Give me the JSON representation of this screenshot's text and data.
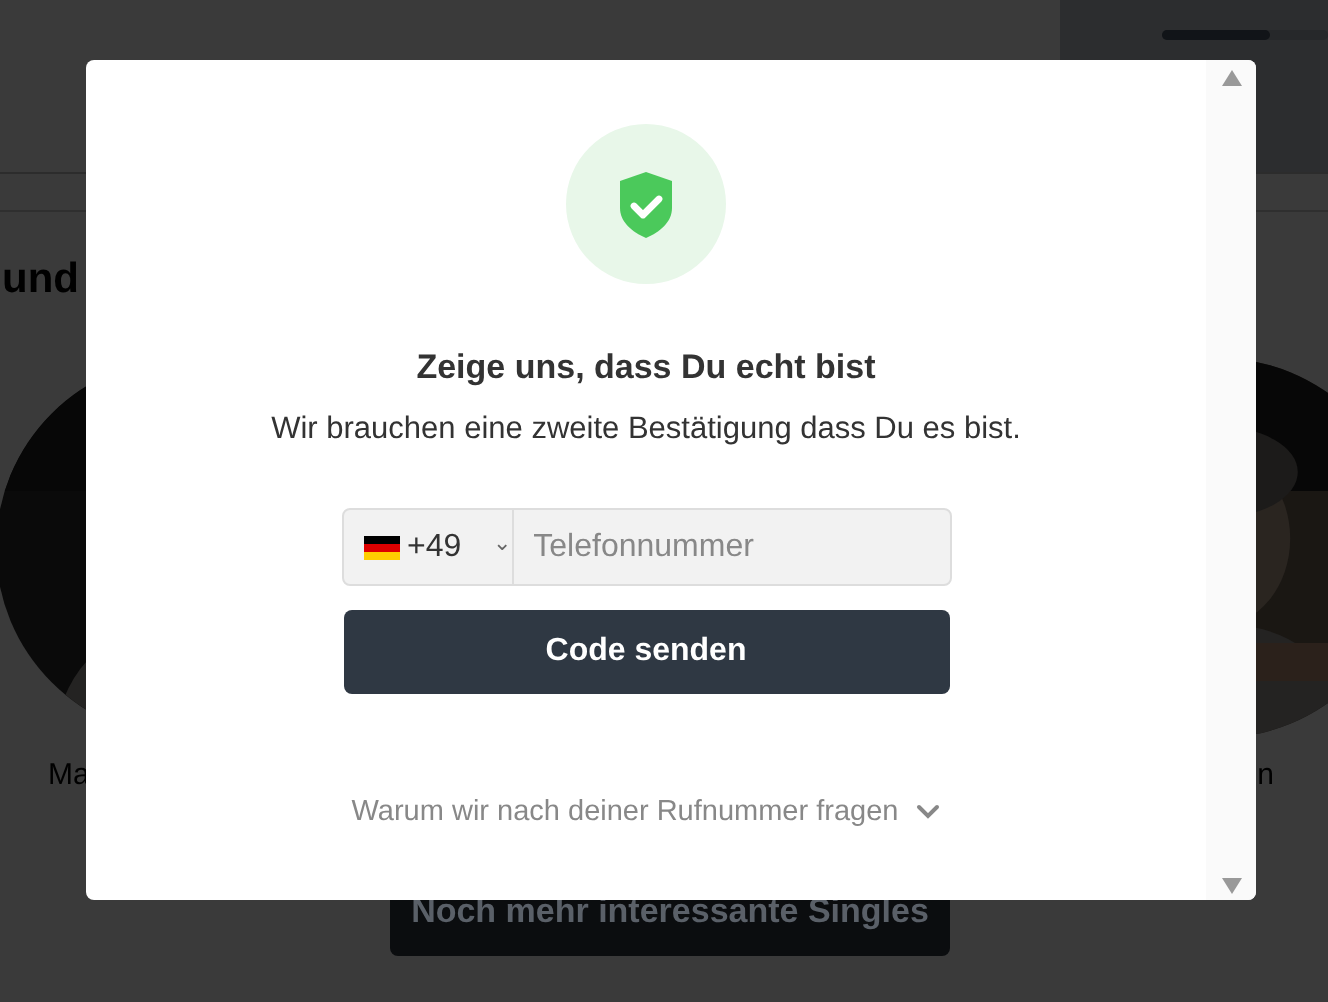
{
  "background_page": {
    "progress": {
      "level": 0.65
    },
    "heading": "und",
    "caption_left": "Ma",
    "caption_right": "n",
    "button": "Noch mehr interessante Singles"
  },
  "dialog": {
    "title": "Zeige uns, dass Du echt bist",
    "subtitle": "Wir brauchen eine zweite Bestätigung dass Du es bist.",
    "phone": {
      "country_code": "+49",
      "caret": "⌄",
      "placeholder": "Telefonnummer"
    },
    "submit": "Code senden",
    "info_link": "Warum wir nach deiner Rufnummer fragen"
  }
}
